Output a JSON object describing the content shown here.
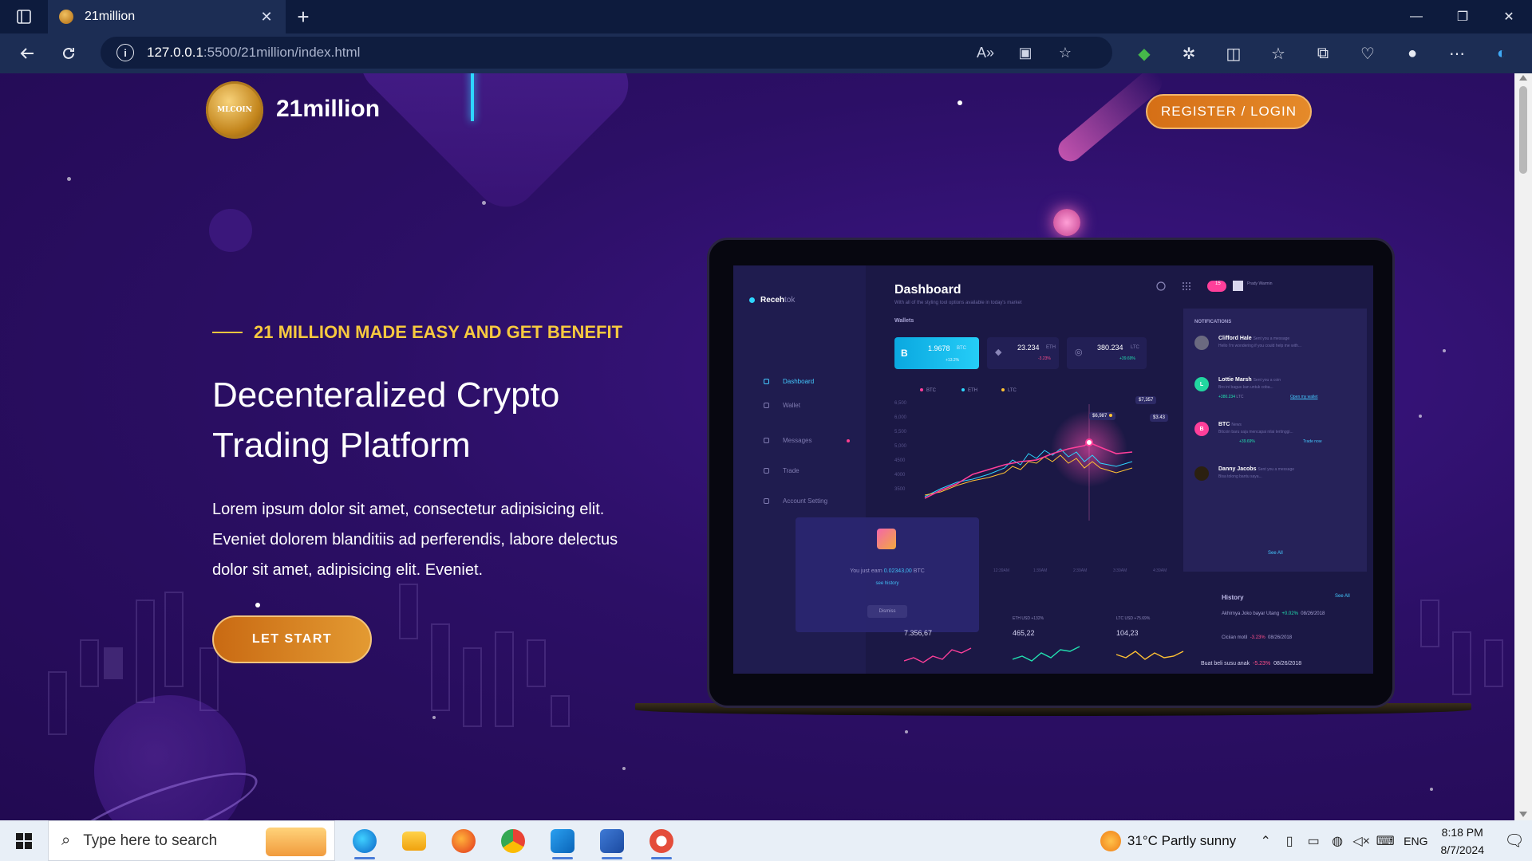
{
  "browser": {
    "tab_title": "21million",
    "url_host": "127.0.0.1",
    "url_path": ":5500/21million/index.html"
  },
  "site": {
    "logo_text": "MLCOIN",
    "brand": "21million",
    "register_label": "REGISTER / LOGIN",
    "tagline": "21 MILLION MADE EASY AND GET BENEFIT",
    "title_line1": "Decenteralized Crypto",
    "title_line2": "Trading Platform",
    "body": "Lorem ipsum dolor sit amet, consectetur adipisicing elit. Eveniet dolorem blanditiis ad perferendis, labore delectus dolor sit amet, adipisicing elit. Eveniet.",
    "start_label": "LET START"
  },
  "dashboard": {
    "logo_main": "Receh",
    "logo_sub": "tok",
    "title": "Dashboard",
    "subtitle": "With all of the styling tool options available in today's market",
    "wallets_label": "Wallets",
    "sidebar": [
      "Dashboard",
      "Wallet",
      "Messages",
      "Trade",
      "Account Setting"
    ],
    "wallets": [
      {
        "symbol": "B",
        "value": "1.9678",
        "unit": "BTC",
        "pct": "+13.2%"
      },
      {
        "value": "23.234",
        "unit": "ETH",
        "pct": "-3.23%"
      },
      {
        "value": "380.234",
        "unit": "LTC",
        "pct": "+39.69%"
      }
    ],
    "legend": [
      "BTC",
      "ETH",
      "LTC"
    ],
    "y_ticks": [
      "6,500",
      "6,000",
      "5,500",
      "5,000",
      "4500",
      "4000",
      "3500"
    ],
    "x_ticks": [
      "12:39AM",
      "1:39AM",
      "2:39AM",
      "3:39AM",
      "4:39AM",
      "5:39AM",
      "6:39AM",
      "7:39AM"
    ],
    "tooltips": [
      "$7,357",
      "$6,987",
      "$3.43"
    ],
    "badge": "15",
    "user": "Prady Warmin",
    "notifications_title": "NOTIFICATIONS",
    "notifications": [
      {
        "name": "Clifford Hale",
        "action": "Sent you a message",
        "sub": "Hello I'm wondering if you could help me with..."
      },
      {
        "name": "Lottie Marsh",
        "action": "Sent you a coin",
        "sub": "Bro ini bagus kan untuk coba...",
        "amount": "+380.234",
        "unit": "LTC",
        "link": "Open my wallet"
      },
      {
        "name": "BTC",
        "action": "News",
        "sub": "Bitcoin baru saja mencapai nilai tertinggi...",
        "pct": "+39.69%",
        "link": "Trade now"
      },
      {
        "name": "Danny Jacobs",
        "action": "Sent you a message",
        "sub": "Bisa tolong bantu saya..."
      }
    ],
    "see_all": "See All",
    "popup": {
      "text_prefix": "You just earn",
      "amount": "0.02343,00",
      "unit": "BTC",
      "link": "see history",
      "button": "Dismiss"
    },
    "mini": [
      {
        "label": "",
        "value": "7.356,67"
      },
      {
        "label": "ETH  USD  +132%",
        "value": "465,22"
      },
      {
        "label": "LTC  USD  +75.69%",
        "value": "104,23"
      }
    ],
    "history_title": "History",
    "history_see": "See All",
    "history": [
      {
        "name": "Akhirnya Joko bayar Utang",
        "pct": "+0.02%",
        "date": "08/26/2018"
      },
      {
        "name": "Ciciian motil",
        "pct": "-3.23%",
        "date": "08/26/2018"
      },
      {
        "name": "Buat beli susu anak",
        "pct": "-5.23%",
        "date": "08/26/2018"
      }
    ]
  },
  "taskbar": {
    "search_placeholder": "Type here to search",
    "weather": "31°C  Partly sunny",
    "lang": "ENG",
    "time": "8:18 PM",
    "date": "8/7/2024"
  }
}
